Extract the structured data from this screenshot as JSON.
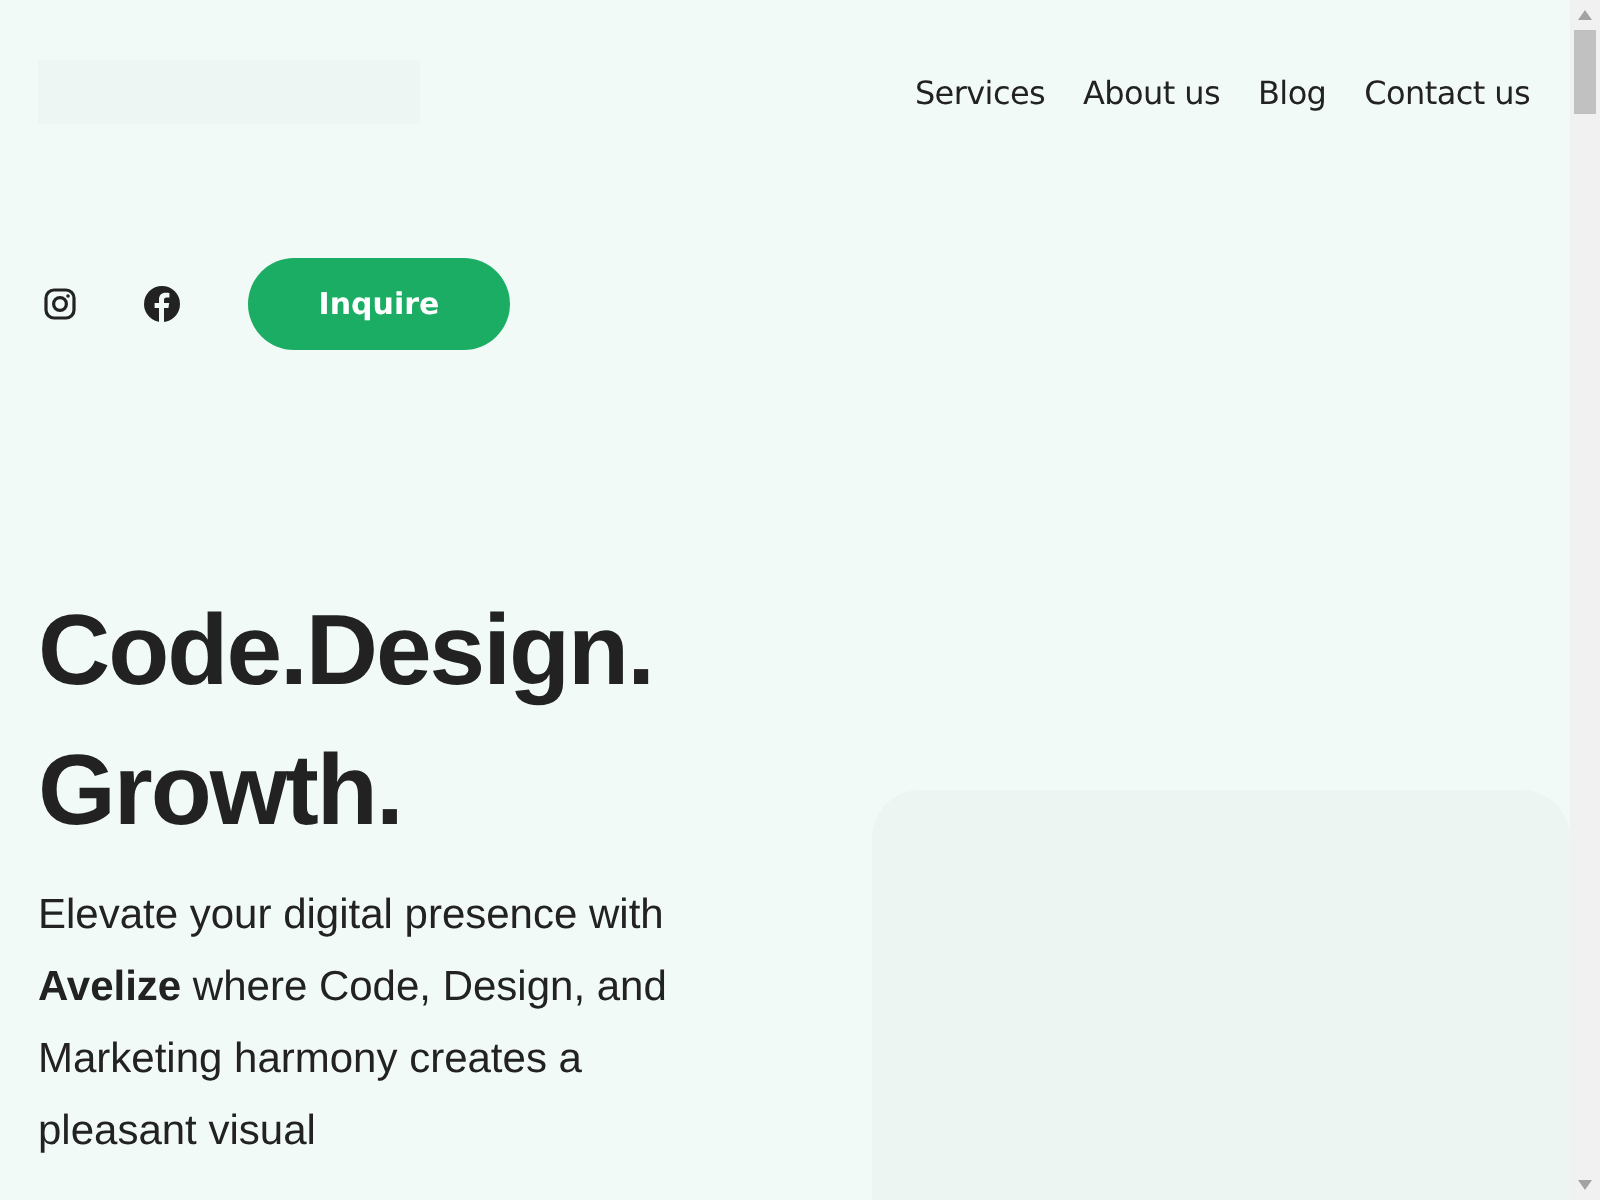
{
  "nav": {
    "items": [
      {
        "label": "Services"
      },
      {
        "label": "About us"
      },
      {
        "label": "Blog"
      },
      {
        "label": "Contact us"
      }
    ]
  },
  "actions": {
    "inquire_button": "Inquire"
  },
  "hero": {
    "heading_lines": [
      "Code.Design.",
      "Growth."
    ],
    "description": "Elevate your digital presence with **Avelize** where Code, Design, and Marketing harmony creates a pleasant visual"
  }
}
